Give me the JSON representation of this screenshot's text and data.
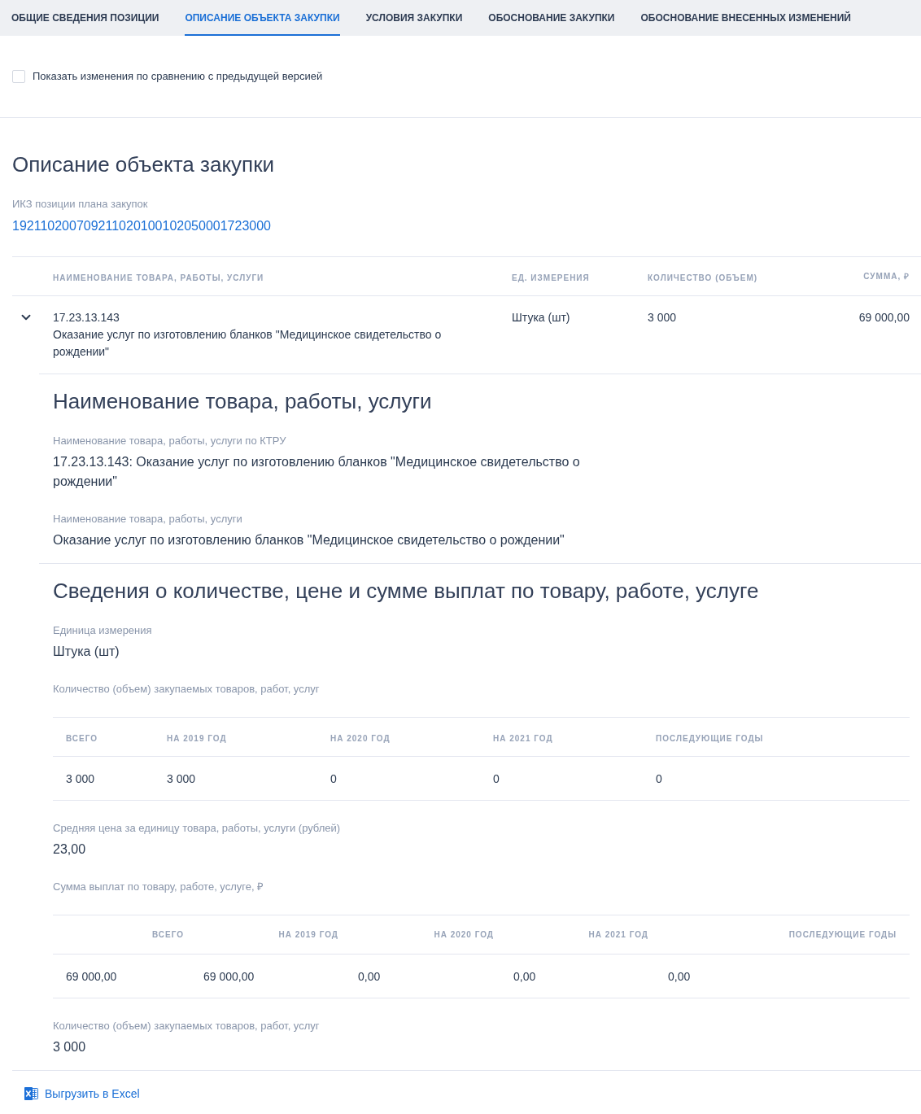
{
  "tabs": [
    {
      "label": "ОБЩИЕ СВЕДЕНИЯ ПОЗИЦИИ",
      "selected": false
    },
    {
      "label": "ОПИСАНИЕ ОБЪЕКТА ЗАКУПКИ",
      "selected": true
    },
    {
      "label": "УСЛОВИЯ ЗАКУПКИ",
      "selected": false
    },
    {
      "label": "ОБОСНОВАНИЕ ЗАКУПКИ",
      "selected": false
    },
    {
      "label": "ОБОСНОВАНИЕ ВНЕСЕННЫХ ИЗМЕНЕНИЙ",
      "selected": false
    }
  ],
  "compare_checkbox": {
    "label": "Показать изменения по сравнению с предыдущей версией",
    "checked": false
  },
  "title": "Описание объекта закупки",
  "ikz": {
    "label": "ИКЗ позиции плана закупок",
    "value": "192110200709211020100102050001723000"
  },
  "items_table": {
    "columns": [
      "НАИМЕНОВАНИЕ ТОВАРА, РАБОТЫ, УСЛУГИ",
      "ЕД. ИЗМЕРЕНИЯ",
      "КОЛИЧЕСТВО (ОБЪЕМ)",
      "СУММА, ₽"
    ],
    "rows": [
      {
        "code": "17.23.13.143",
        "name": "Оказание услуг по изготовлению бланков \"Медицинское свидетельство о рождении\"",
        "unit": "Штука (шт)",
        "quantity": "3 000",
        "sum": "69 000,00",
        "expanded": true,
        "details": [
          {
            "title": "Наименование товара, работы, услуги",
            "blocks": [
              {
                "kind": "field",
                "label": "Наименование товара, работы, услуги по КТРУ",
                "value": "17.23.13.143: Оказание услуг по изготовлению бланков \"Медицинское свидетельство о рождении\""
              },
              {
                "kind": "field",
                "label": "Наименование товара, работы, услуги",
                "value": "Оказание услуг по изготовлению бланков \"Медицинское свидетельство о рождении\""
              }
            ]
          },
          {
            "title": "Сведения о количестве, цене и сумме выплат по товару, работе, услуге",
            "blocks": [
              {
                "kind": "field",
                "label": "Единица измерения",
                "value": "Штука (шт)"
              },
              {
                "kind": "quantities",
                "label": "Количество (объем) закупаемых товаров, работ, услуг",
                "columns": [
                  "ВСЕГО",
                  "НА 2019 ГОД",
                  "НА 2020 ГОД",
                  "НА 2021 ГОД",
                  "ПОСЛЕДУЮЩИЕ ГОДЫ"
                ],
                "rows": [
                  [
                    "3 000",
                    "3 000",
                    "0",
                    "0",
                    "0"
                  ]
                ]
              },
              {
                "kind": "field",
                "label": "Средняя цена за единицу товара, работы, услуги (рублей)",
                "value": "23,00"
              },
              {
                "kind": "amounts",
                "label": "Сумма выплат по товару, работе, услуге, ₽",
                "columns": [
                  "ВСЕГО",
                  "НА 2019 ГОД",
                  "НА 2020 ГОД",
                  "НА 2021 ГОД",
                  "ПОСЛЕДУЮЩИЕ ГОДЫ"
                ],
                "rows": [
                  [
                    "69 000,00",
                    "69 000,00",
                    "0,00",
                    "0,00",
                    "0,00"
                  ]
                ]
              },
              {
                "kind": "field",
                "label": "Количество (объем) закупаемых товаров, работ, услуг",
                "value": "3 000"
              }
            ]
          }
        ]
      }
    ]
  },
  "export_link": {
    "label": "Выгрузить в Excel"
  }
}
